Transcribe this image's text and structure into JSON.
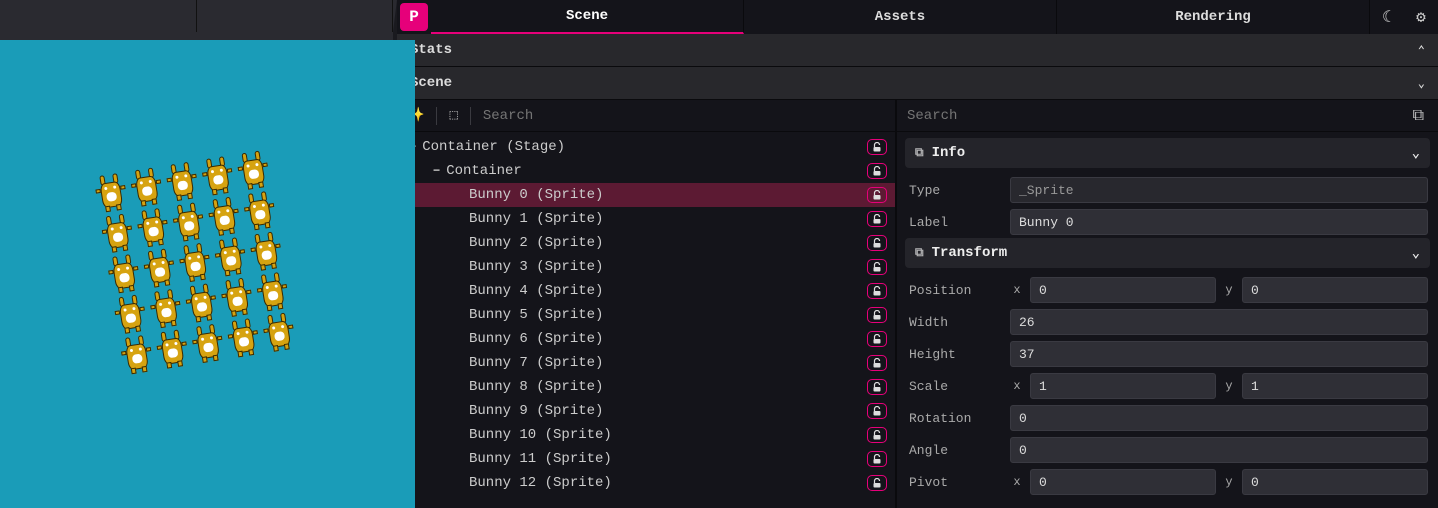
{
  "tabs": {
    "scene": "Scene",
    "assets": "Assets",
    "rendering": "Rendering"
  },
  "sections": {
    "stats": "Stats",
    "scene": "Scene"
  },
  "search": {
    "tree_placeholder": "Search",
    "props_placeholder": "Search"
  },
  "tree": {
    "root": "Container (Stage)",
    "container": "Container",
    "items": [
      "Bunny 0 (Sprite)",
      "Bunny 1 (Sprite)",
      "Bunny 2 (Sprite)",
      "Bunny 3 (Sprite)",
      "Bunny 4 (Sprite)",
      "Bunny 5 (Sprite)",
      "Bunny 6 (Sprite)",
      "Bunny 7 (Sprite)",
      "Bunny 8 (Sprite)",
      "Bunny 9 (Sprite)",
      "Bunny 10 (Sprite)",
      "Bunny 11 (Sprite)",
      "Bunny 12 (Sprite)"
    ],
    "selected_index": 0
  },
  "props": {
    "info_label": "Info",
    "transform_label": "Transform",
    "type": {
      "label": "Type",
      "value": "_Sprite"
    },
    "label": {
      "label": "Label",
      "value": "Bunny 0"
    },
    "position": {
      "label": "Position",
      "x": "0",
      "y": "0"
    },
    "width": {
      "label": "Width",
      "value": "26"
    },
    "height": {
      "label": "Height",
      "value": "37"
    },
    "scale": {
      "label": "Scale",
      "x": "1",
      "y": "1"
    },
    "rotation": {
      "label": "Rotation",
      "value": "0"
    },
    "angle": {
      "label": "Angle",
      "value": "0"
    },
    "pivot": {
      "label": "Pivot",
      "x": "0",
      "y": "0"
    }
  },
  "labels": {
    "x": "x",
    "y": "y"
  },
  "accent": "#e6007a",
  "canvas_bg": "#1a9cb8"
}
